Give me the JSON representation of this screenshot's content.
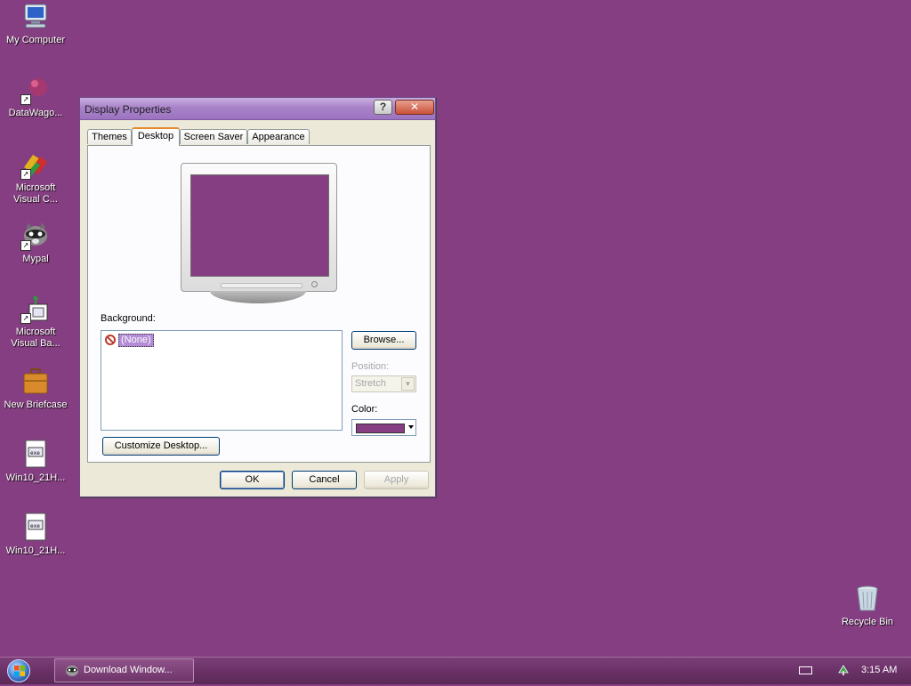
{
  "desktop": {
    "background_color": "#853e81",
    "icons": [
      {
        "label": "My Computer",
        "icon": "computer-icon"
      },
      {
        "label": "DataWago...",
        "icon": "datawagon-icon"
      },
      {
        "label": "Microsoft\nVisual C...",
        "icon": "visual-c-icon"
      },
      {
        "label": "Mypal",
        "icon": "mypal-icon"
      },
      {
        "label": "Microsoft\nVisual Ba...",
        "icon": "visual-basic-icon"
      },
      {
        "label": "New Briefcase",
        "icon": "briefcase-icon"
      },
      {
        "label": "Win10_21H...",
        "icon": "document-icon"
      },
      {
        "label": "Win10_21H...",
        "icon": "document-icon"
      },
      {
        "label": "Recycle Bin",
        "icon": "recycle-bin-icon"
      }
    ]
  },
  "dialog": {
    "title": "Display Properties",
    "help_label": "?",
    "close_label": "✕",
    "tabs": [
      {
        "label": "Themes",
        "active": false
      },
      {
        "label": "Desktop",
        "active": true
      },
      {
        "label": "Screen Saver",
        "active": false
      },
      {
        "label": "Appearance",
        "active": false
      }
    ],
    "background_label": "Background:",
    "background_items": [
      {
        "label": "(None)",
        "icon": "none-icon",
        "selected": true
      }
    ],
    "browse_label": "Browse...",
    "position_label": "Position:",
    "position_value": "Stretch",
    "color_label": "Color:",
    "color_value": "#853e81",
    "customize_label": "Customize Desktop...",
    "ok_label": "OK",
    "cancel_label": "Cancel",
    "apply_label": "Apply"
  },
  "taskbar": {
    "task_button_label": "Download Window...",
    "clock": "3:15 AM"
  }
}
